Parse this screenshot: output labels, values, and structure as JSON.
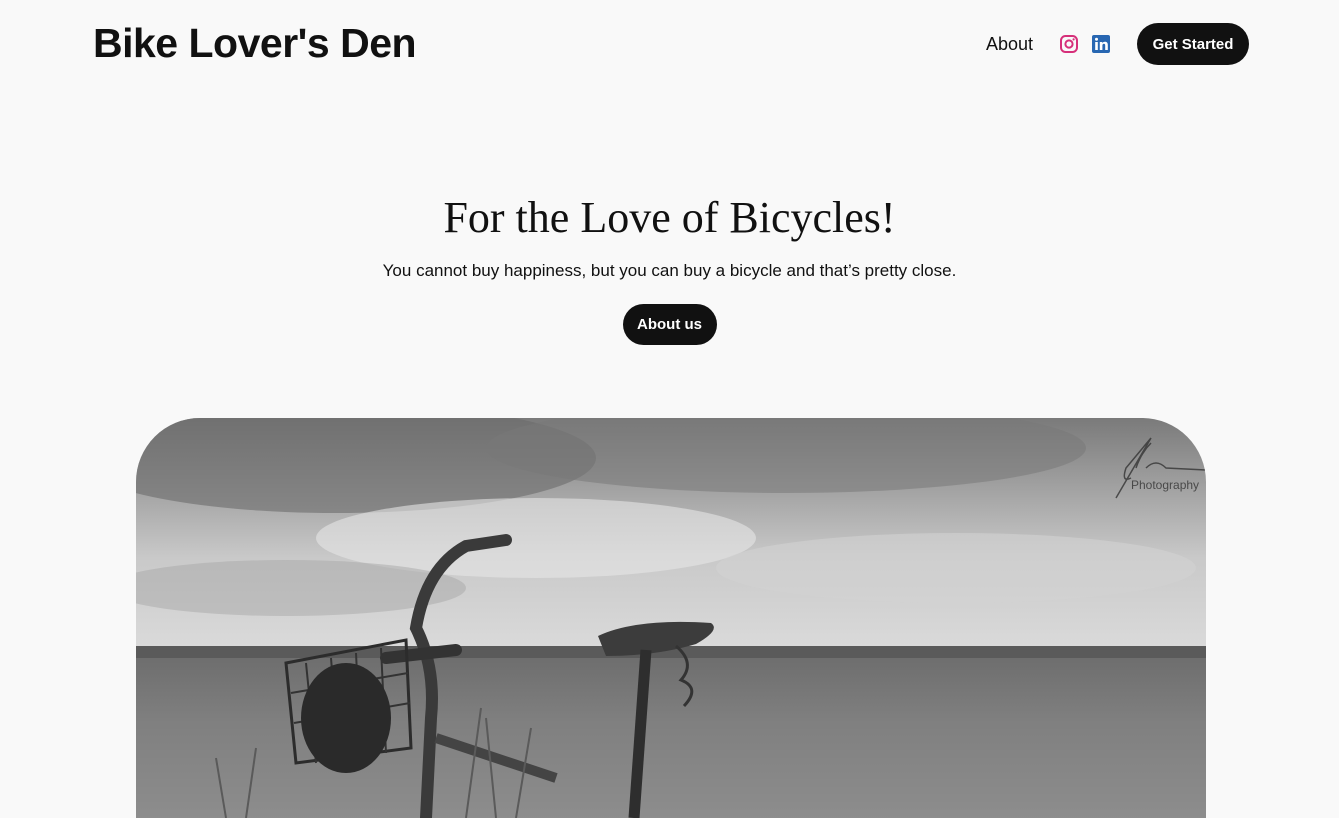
{
  "header": {
    "site_title": "Bike Lover's Den",
    "nav": {
      "about_label": "About"
    },
    "social": [
      {
        "icon": "instagram-icon",
        "color": "#d6307a"
      },
      {
        "icon": "linkedin-icon",
        "color": "#2867b2"
      }
    ],
    "cta_label": "Get Started"
  },
  "hero": {
    "title": "For the Love of Bicycles!",
    "subtitle": "You cannot buy happiness, but you can buy a bicycle and that’s pretty close.",
    "button_label": "About us"
  },
  "image": {
    "watermark_text": "Photography",
    "description_icon": "bicycle-photo"
  },
  "colors": {
    "background": "#f9f9f9",
    "text": "#111111",
    "button_bg": "#111111",
    "button_text": "#ffffff"
  }
}
